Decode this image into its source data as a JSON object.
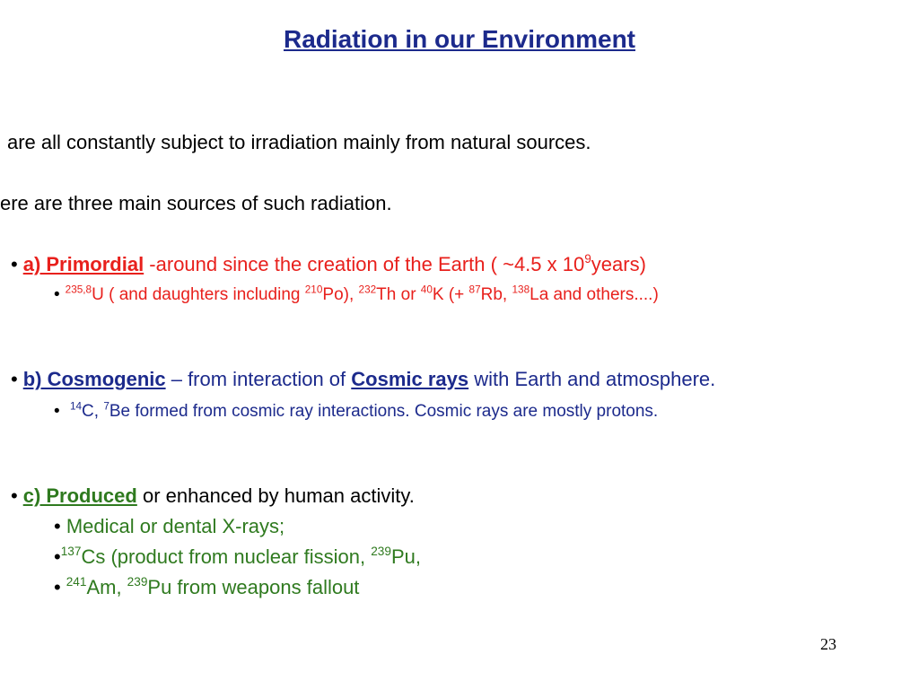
{
  "title": "Radiation in our Environment",
  "intro": [
    "are all constantly subject to irradiation mainly from natural sources.",
    "ere are three main sources of such radiation."
  ],
  "bullet_char": "•",
  "primordial": {
    "heading": "a) Primordial",
    "desc_a": " -around since the creation of the Earth ( ",
    "approx": "~",
    "desc_b": "4.5 x 10",
    "exp": "9",
    "desc_c": "years)",
    "detail": {
      "s1": "235,8",
      "t1": "U ( and daughters including ",
      "s2": "210",
      "t2": "Po), ",
      "s3": "232",
      "t3": "Th or ",
      "s4": "40",
      "t4": "K (+ ",
      "s5": "87",
      "t5": "Rb, ",
      "s6": "138",
      "t6": "La and others....)"
    }
  },
  "cosmogenic": {
    "heading": "b) Cosmogenic",
    "desc_a": " – from interaction of ",
    "link": "Cosmic rays",
    "desc_b": " with Earth and atmosphere.",
    "detail": {
      "s1": "14",
      "t1": "C, ",
      "s2": "7",
      "t2": "Be formed from cosmic ray interactions. Cosmic rays are mostly protons."
    }
  },
  "produced": {
    "heading": "c) Produced",
    "desc": "  or enhanced by human activity.",
    "item1": " Medical or dental X-rays;",
    "item2": {
      "s1": "137",
      "t1": "Cs (product from nuclear fission, ",
      "s2": "239",
      "t2": "Pu,"
    },
    "item3": {
      "s1": "241",
      "t1": "Am, ",
      "s2": "239",
      "t2": "Pu from weapons fallout"
    }
  },
  "page_number": "23",
  "colors": {
    "title": "#1c2a8c",
    "primordial": "#e8201c",
    "cosmogenic": "#1c2a8c",
    "produced": "#2f7a1f",
    "text": "#000000"
  }
}
